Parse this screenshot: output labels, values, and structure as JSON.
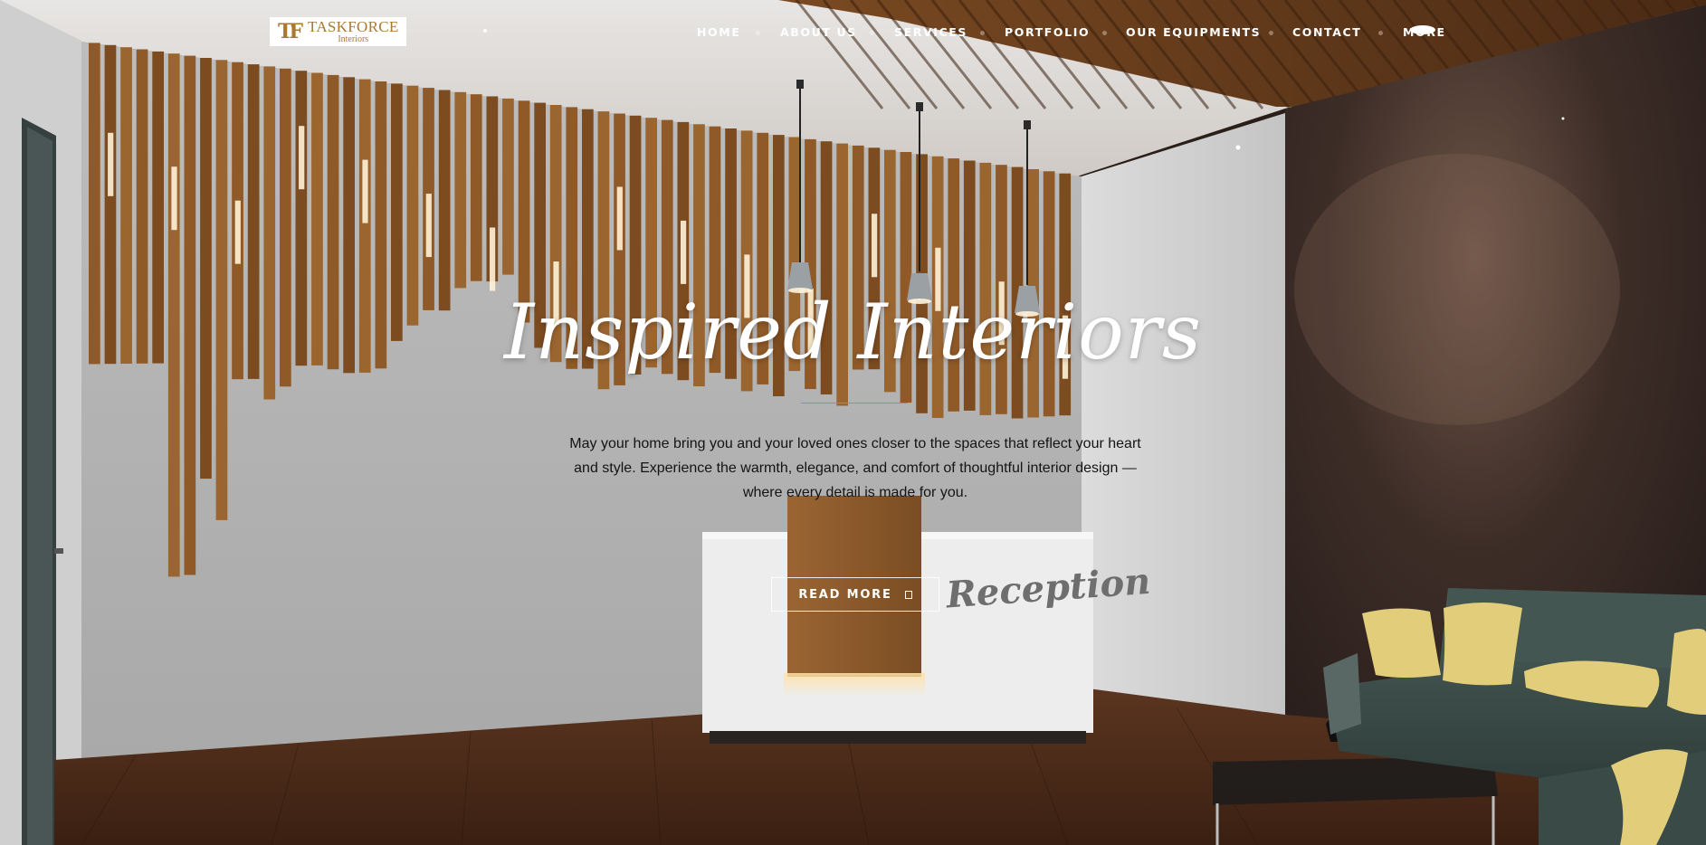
{
  "header": {
    "logo": {
      "mark": "TF",
      "name": "TASKFORCE",
      "subtitle": "Interiors"
    },
    "nav": [
      {
        "label": "HOME"
      },
      {
        "label": "ABOUT US"
      },
      {
        "label": "SERVICES"
      },
      {
        "label": "PORTFOLIO"
      },
      {
        "label": "OUR EQUIPMENTS"
      },
      {
        "label": "CONTACT"
      },
      {
        "label": "MORE"
      }
    ]
  },
  "hero": {
    "title": "Inspired Interiors",
    "body": "May your home bring you and your loved ones closer to the spaces that reflect your heart and style. Experience the warmth, elegance, and comfort of thoughtful interior design — where every detail is made for you.",
    "button": {
      "label": "READ MORE",
      "icon": "square-icon"
    },
    "background": {
      "desk_sign": "Reception",
      "colors": {
        "wood": "#8a5526",
        "wall": "#c9c9c9",
        "floor": "#4a2a18",
        "sofa": "#3d504b",
        "cushion": "#e3cf7e",
        "accent_line": "#7e8fc4"
      }
    }
  }
}
